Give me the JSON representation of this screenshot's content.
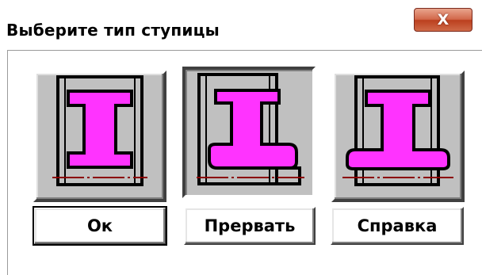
{
  "window": {
    "title": "Выберите тип ступицы",
    "close_glyph": "X"
  },
  "hub_options": [
    {
      "name": "hub-type-1",
      "state": "raised"
    },
    {
      "name": "hub-type-2",
      "state": "pressed"
    },
    {
      "name": "hub-type-3",
      "state": "raised"
    }
  ],
  "buttons": {
    "ok_label": "Ок",
    "abort_label": "Прервать",
    "help_label": "Справка"
  },
  "colors": {
    "hub_fill": "#ff33ff",
    "axis_line": "#8b0000",
    "panel_bg": "#c0c0c0",
    "close_red": "#cf5c3d"
  }
}
